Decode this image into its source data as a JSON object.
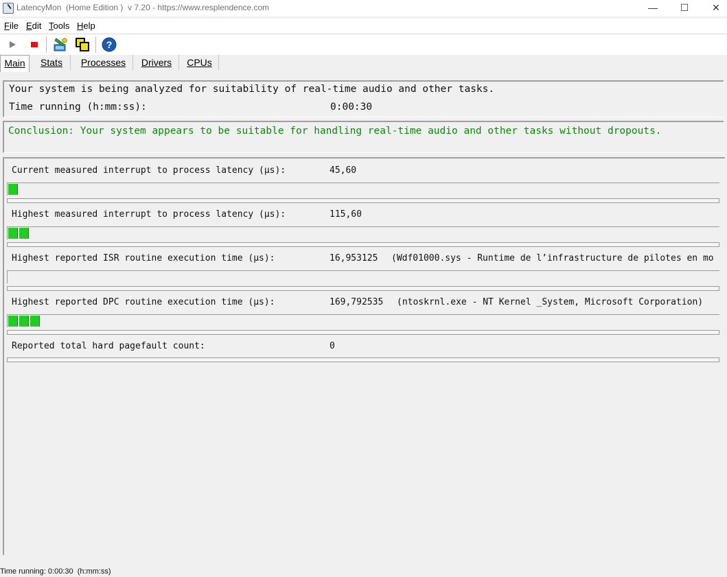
{
  "window": {
    "title": "LatencyMon  (Home Edition )  v 7.20 - https://www.resplendence.com",
    "minimize_glyph": "—",
    "maximize_glyph": "☐",
    "close_glyph": "✕"
  },
  "menu": [
    {
      "key": "F",
      "rest": "ile"
    },
    {
      "key": "E",
      "rest": "dit"
    },
    {
      "key": "T",
      "rest": "ools"
    },
    {
      "key": "H",
      "rest": "elp"
    }
  ],
  "toolbar": {
    "icons": [
      "play-icon",
      "stop-icon",
      "analyze-icon",
      "windows-icon",
      "help-icon"
    ],
    "colors": {
      "play": "#808080",
      "stop": "#e81010",
      "help": "#1e5bb0"
    }
  },
  "tabs": [
    "Main",
    "Stats",
    "Processes",
    "Drivers",
    "CPUs"
  ],
  "summary": {
    "analyzing_text": "Your system is being analyzed for suitability of real-time audio and other tasks.",
    "time_label": "Time running (h:mm:ss):",
    "time_value": "0:00:30"
  },
  "conclusion": {
    "text": "Conclusion: Your system appears to be suitable for handling real-time audio and other tasks without dropouts.",
    "color": "#0a8a0a"
  },
  "metrics": [
    {
      "label": "Current measured interrupt to process latency (µs):",
      "value": "45,60",
      "extra": "",
      "segments": 1
    },
    {
      "label": "Highest measured interrupt to process latency (µs):",
      "value": "115,60",
      "extra": "",
      "segments": 2
    },
    {
      "label": "Highest reported ISR routine execution time (µs):",
      "value": "16,953125",
      "extra": "(Wdf01000.sys - Runtime de l’infrastructure de pilotes en mo",
      "segments": 0
    },
    {
      "label": "Highest reported DPC routine execution time (µs):",
      "value": "169,792535",
      "extra": "(ntoskrnl.exe - NT Kernel _System, Microsoft Corporation)",
      "segments": 3
    },
    {
      "label": "Reported total hard pagefault count:",
      "value": "0",
      "extra": "",
      "segments": 0
    }
  ],
  "bar_color": "#22cc22",
  "statusbar": {
    "text": "Time running: 0:00:30  (h:mm:ss)"
  }
}
